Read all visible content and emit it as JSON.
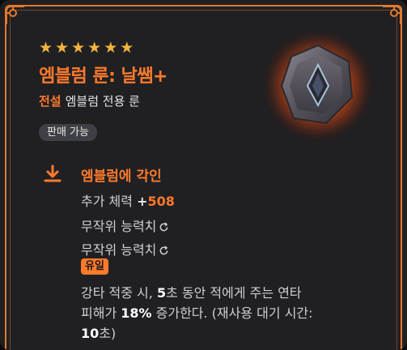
{
  "item": {
    "stars": 6,
    "star_glyph": "★",
    "name": "엠블럼 룬: 날쌤+",
    "rarity": "전설",
    "type": "엠블럼 전용 룬",
    "sellable": "판매 가능",
    "icon": "hexagon-rune-gem"
  },
  "section": {
    "icon": "download-arrow-icon",
    "title": "엠블럼에 각인"
  },
  "stats": [
    {
      "label": "추가 체력 ",
      "sign": "+",
      "value": "508"
    },
    {
      "label": "무작위 능력치",
      "icon": "reroll-icon"
    },
    {
      "label": "무작위 능력치",
      "icon": "reroll-icon"
    }
  ],
  "unique_tag": "유일",
  "description": {
    "l1_a": "강타 적중 시, ",
    "l1_b": "5",
    "l1_c": "초 동안 적에게 주는 연타",
    "l2_a": "피해가 ",
    "l2_b": "18%",
    "l2_c": " 증가한다. (재사용 대기 시간:",
    "l3_a": "10",
    "l3_b": "초)"
  },
  "colors": {
    "accent": "#ff7a2b",
    "star": "#f3b33d",
    "background": "#202023",
    "frame": "#e07a2e"
  }
}
